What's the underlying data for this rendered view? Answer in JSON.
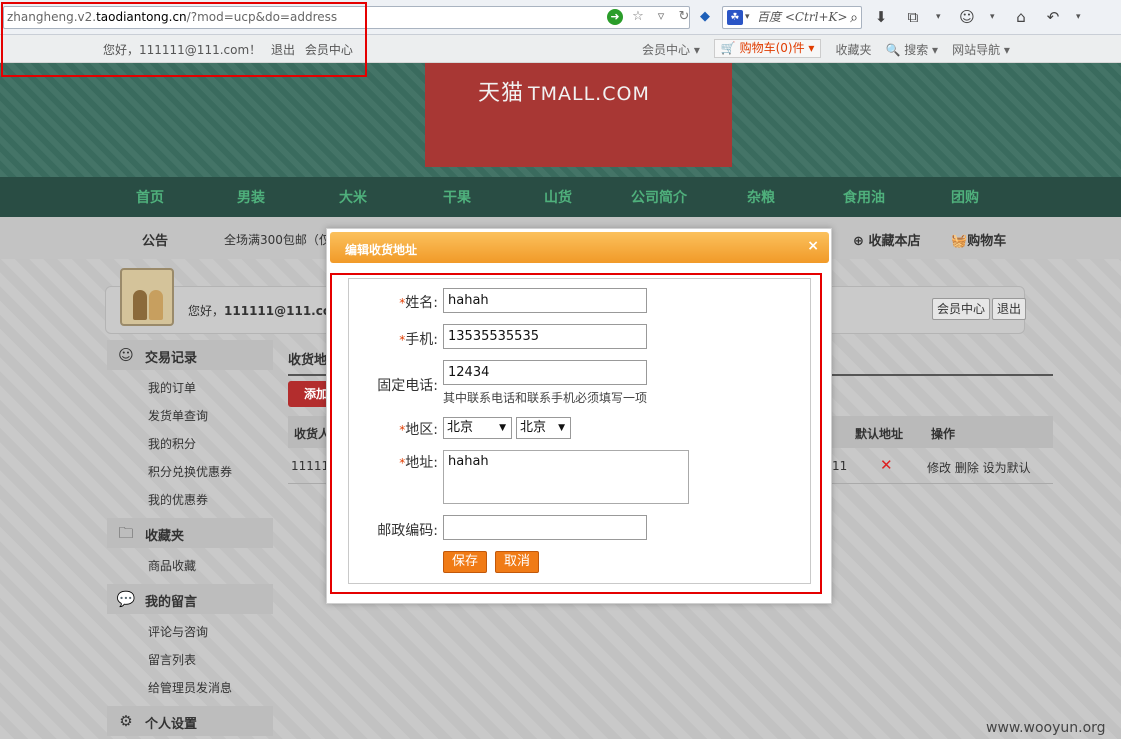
{
  "browser": {
    "url_scheme": "zhangheng.v2.",
    "url_host": "taodiantong.cn",
    "url_path": "/?mod=ucp&do=address",
    "search_placeholder": "百度 <Ctrl+K>"
  },
  "topbar": {
    "greeting": "您好，111111@111.com！",
    "logout": "退出",
    "member_center": "会员中心",
    "member_menu": "会员中心 ▾",
    "cart": "🛒 购物车(0)件  ▾",
    "favorites": "收藏夹",
    "search": "🔍 搜索 ▾",
    "site_nav": "网站导航 ▾"
  },
  "header": {
    "logo_cn": "天猫",
    "logo_en": "TMALL.COM"
  },
  "nav": [
    "首页",
    "男装",
    "大米",
    "干果",
    "山货",
    "公司简介",
    "杂粮",
    "食用油",
    "团购"
  ],
  "notice": {
    "title": "公告",
    "text": "全场满300包邮（仅",
    "fav_shop": "收藏本店",
    "cart": "购物车"
  },
  "user": {
    "hello_prefix": "您好，",
    "hello_name": "111111@111.cor",
    "member_btn": "会员中心",
    "logout_btn": "退出"
  },
  "sidebar": {
    "sections": [
      {
        "label": "交易记录",
        "items": [
          "我的订单",
          "发货单查询",
          "我的积分",
          "积分兑换优惠券",
          "我的优惠券"
        ]
      },
      {
        "label": "收藏夹",
        "items": [
          "商品收藏"
        ]
      },
      {
        "label": "我的留言",
        "items": [
          "评论与咨询",
          "留言列表",
          "给管理员发消息"
        ]
      },
      {
        "label": "个人设置",
        "items": []
      }
    ]
  },
  "content": {
    "title": "收货地",
    "add_btn": "添加",
    "headers": {
      "receiver": "收货人",
      "default": "默认地址",
      "ops": "操作"
    },
    "row": {
      "receiver": "11111",
      "phone_tail": "11",
      "ops": "修改 删除 设为默认"
    }
  },
  "modal": {
    "title": "编辑收货地址",
    "close": "×",
    "fields": {
      "name_label": "姓名:",
      "name_value": "hahah",
      "mobile_label": "手机:",
      "mobile_value": "13535535535",
      "phone_label": "固定电话:",
      "phone_value": "12434",
      "phone_hint": "其中联系电话和联系手机必须填写一项",
      "region_label": "地区:",
      "province": "北京",
      "city": "北京",
      "address_label": "地址:",
      "address_value": "hahah",
      "zip_label": "邮政编码:",
      "zip_value": ""
    },
    "save": "保存",
    "cancel": "取消"
  },
  "watermark": "www.wooyun.org",
  "colors": {
    "header_green": "#3c6e61",
    "nav_green": "#4fb07c",
    "logo_red": "#a83734",
    "modal_orange": "#f6a93c",
    "annotation_red": "#e50000"
  }
}
